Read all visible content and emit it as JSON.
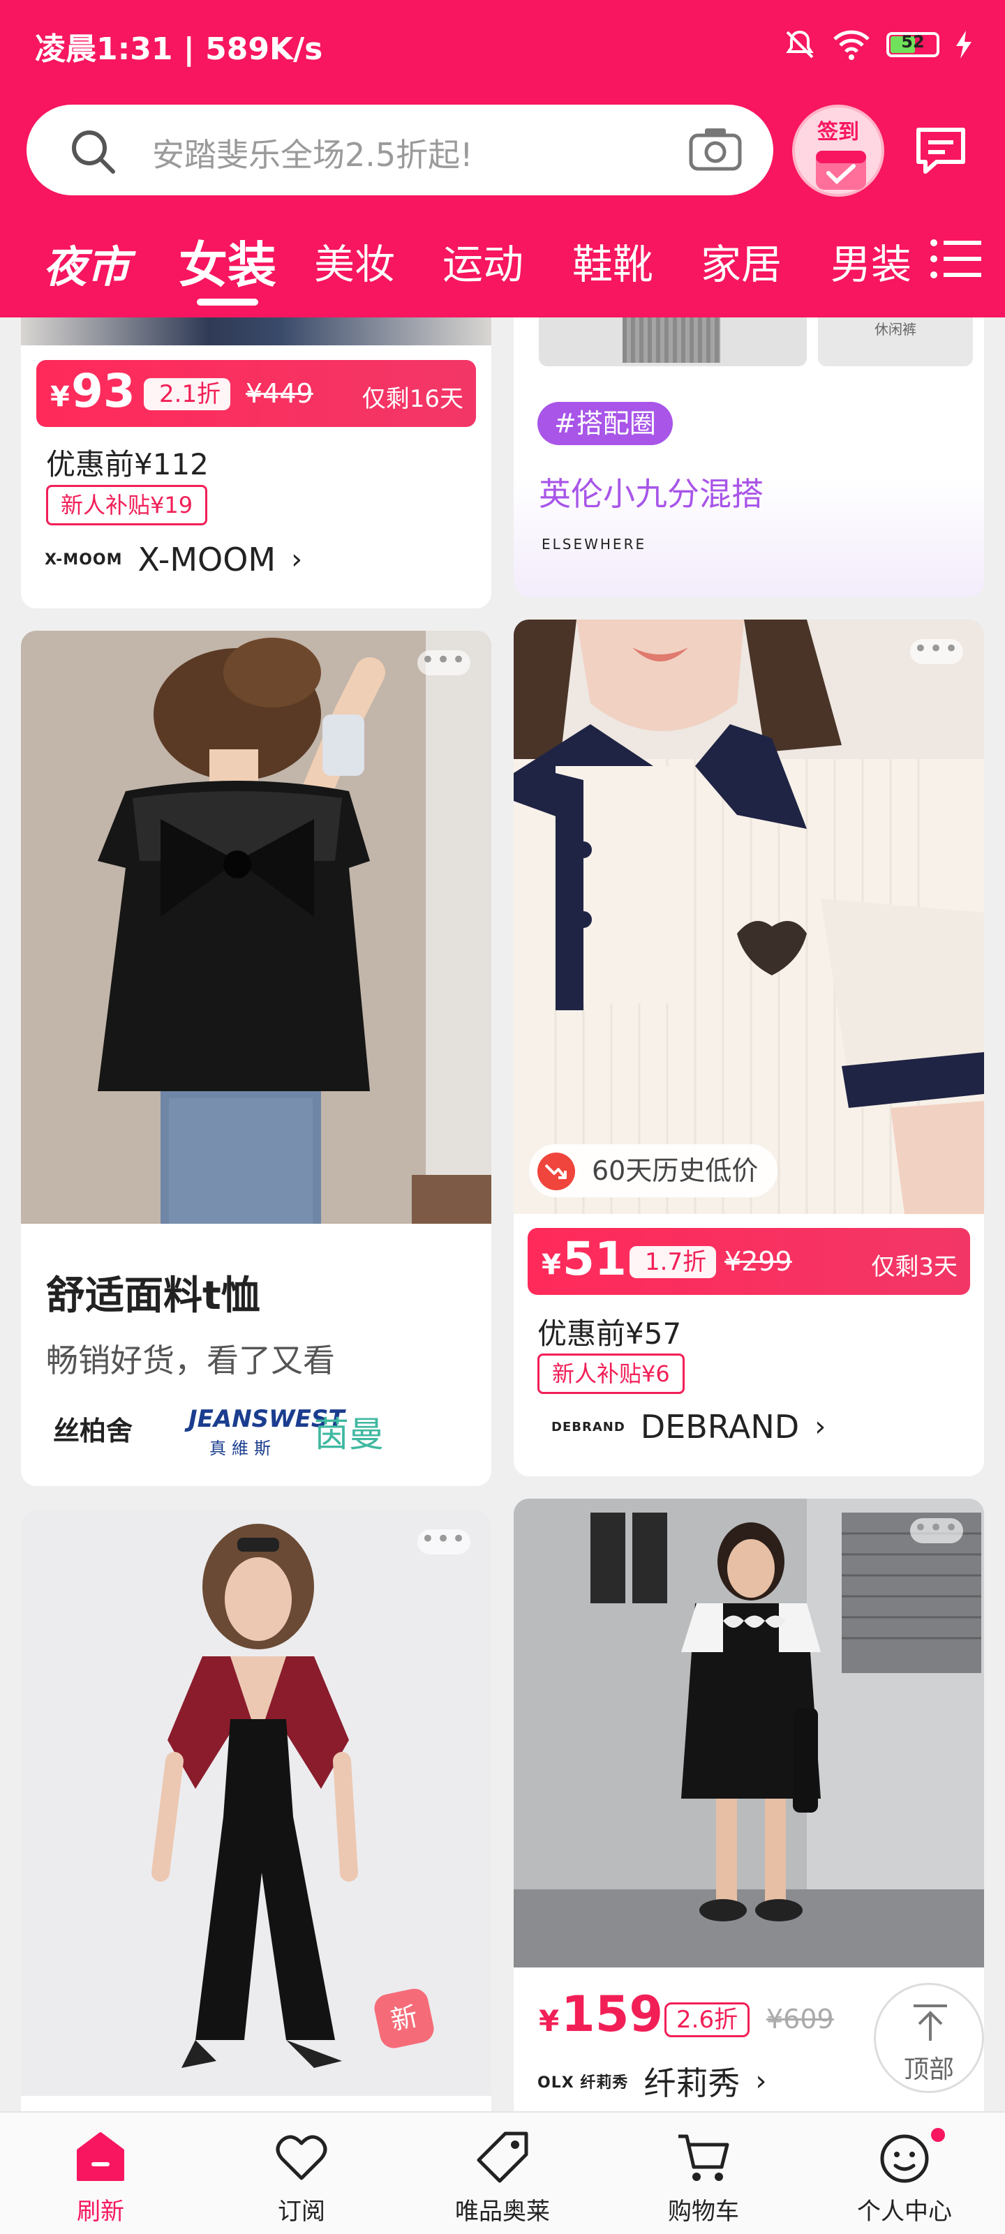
{
  "status_bar": {
    "time": "凌晨1:31 | 589K/s",
    "battery": "52"
  },
  "search": {
    "placeholder": "安踏斐乐全场2.5折起!"
  },
  "checkin": {
    "label": "签到"
  },
  "tabs": {
    "night_market": "夜市",
    "items": [
      "女装",
      "美妆",
      "运动",
      "鞋靴",
      "家居",
      "男装"
    ],
    "active_index": 0
  },
  "cards": {
    "xmoom": {
      "price_yen": "¥",
      "price": "93",
      "discount": "2.1折",
      "original": "¥449",
      "remaining": "仅剩16天",
      "pre_coupon": "优惠前¥112",
      "newbie": "新人补贴¥19",
      "brand_logo": "X-MOOM",
      "brand_name": "X-MOOM"
    },
    "elsewhere": {
      "tag": "#搭配圈",
      "title": "英伦小九分混搭",
      "brand_logo": "ELSEWHERE",
      "thumb_label": "休闲裤"
    },
    "tshirt_topic": {
      "title": "舒适面料t恤",
      "subtitle": "畅销好货，看了又看",
      "brands": [
        "丝柏舍",
        "JEANSWEST",
        "茵曼"
      ],
      "brand_sub": "真維斯"
    },
    "debrand": {
      "history_low": "60天历史低价",
      "price_yen": "¥",
      "price": "51",
      "discount": "1.7折",
      "original": "¥299",
      "remaining": "仅剩3天",
      "pre_coupon": "优惠前¥57",
      "newbie": "新人补贴¥6",
      "brand_logo": "DEBRAND",
      "brand_name": "DEBRAND"
    },
    "jumpsuit": {
      "new_badge": "新"
    },
    "qianlixiu": {
      "price_yen": "¥",
      "price": "159",
      "discount": "2.6折",
      "original": "¥609",
      "brand_logo": "OLX 纤莉秀",
      "brand_name": "纤莉秀"
    }
  },
  "to_top": {
    "label": "顶部"
  },
  "bottom_nav": [
    {
      "label": "刷新",
      "icon": "home-icon"
    },
    {
      "label": "订阅",
      "icon": "heart-icon"
    },
    {
      "label": "唯品奥莱",
      "icon": "tag-icon"
    },
    {
      "label": "购物车",
      "icon": "cart-icon"
    },
    {
      "label": "个人中心",
      "icon": "smile-icon"
    }
  ],
  "colors": {
    "brand": "#f7165f",
    "price_red": "#f21f57",
    "purple": "#a855e8"
  }
}
